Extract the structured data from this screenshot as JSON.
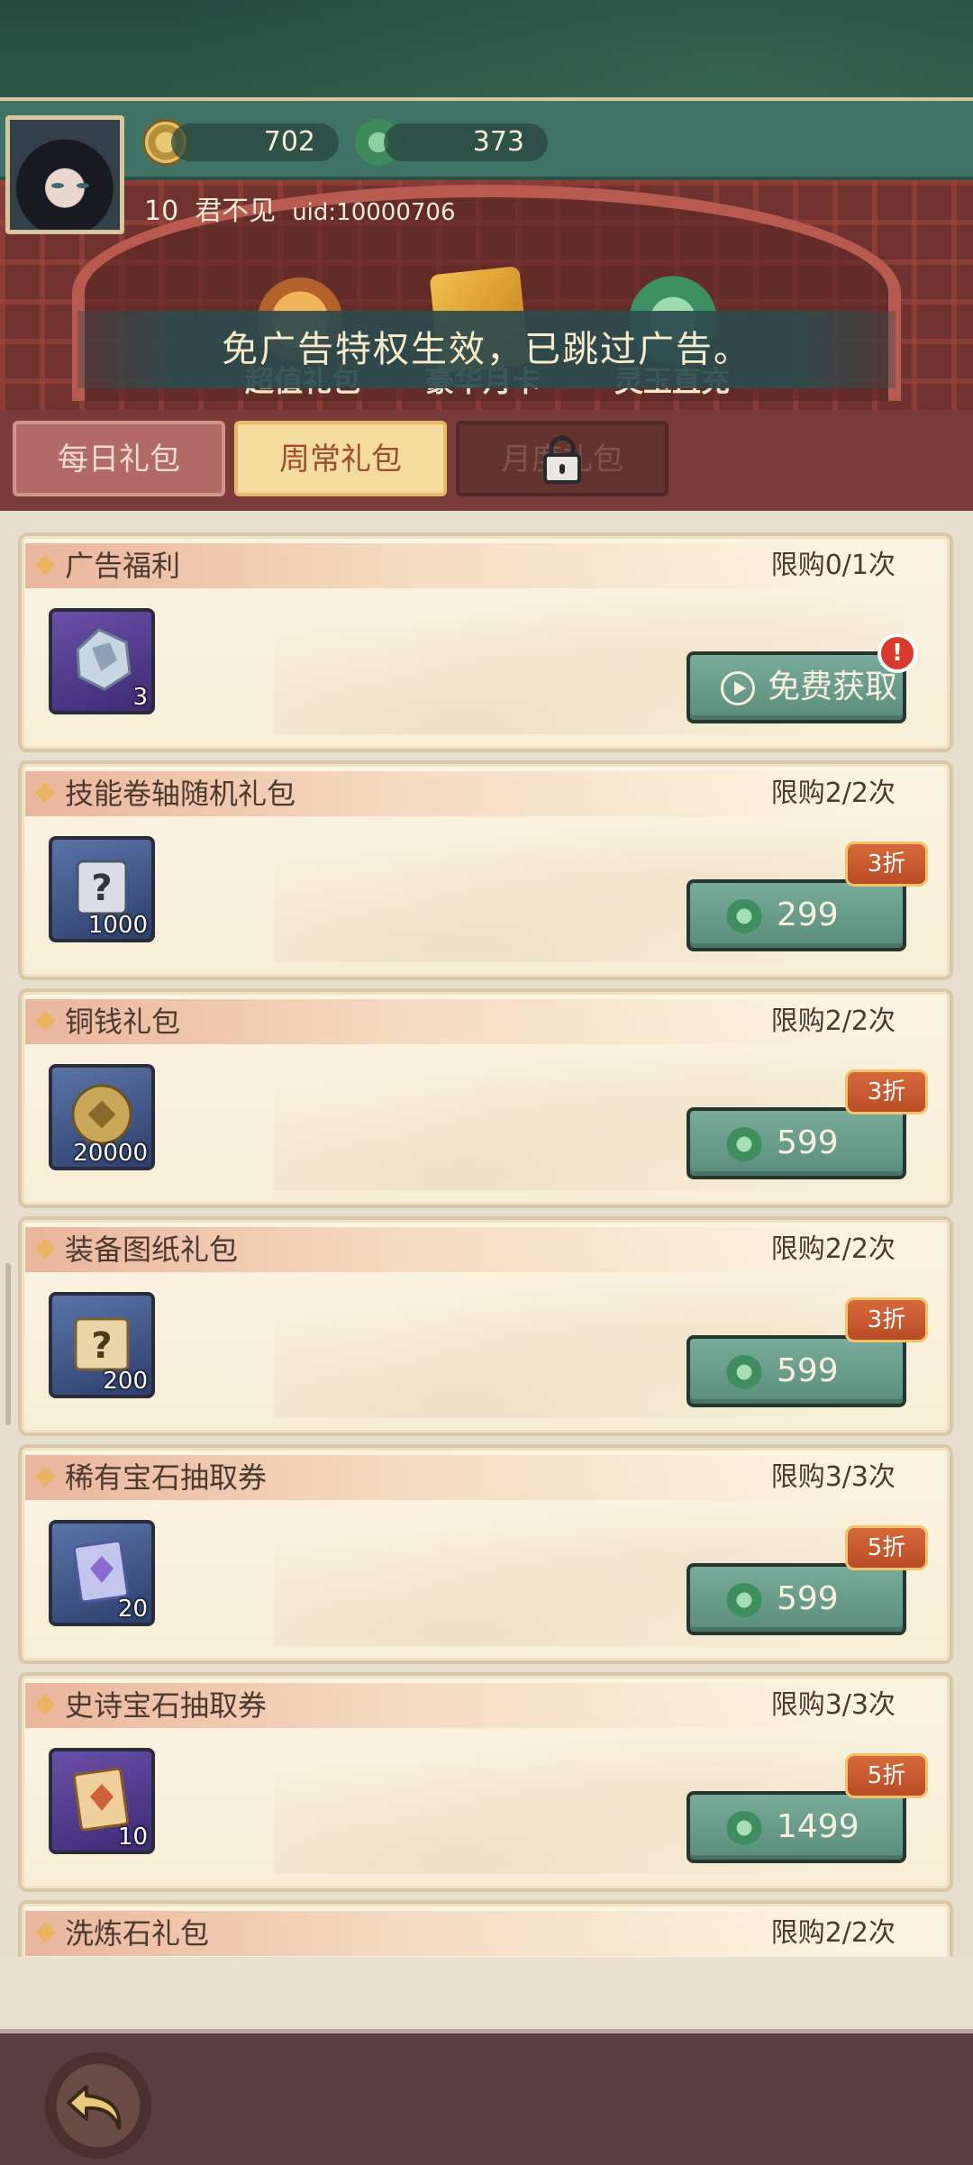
{
  "player": {
    "coins": "702",
    "jade": "373",
    "level": "10",
    "name": "君不见",
    "uid": "uid:10000706"
  },
  "top_categories": [
    {
      "label": "超值礼包",
      "icon": "gourd-icon"
    },
    {
      "label": "豪华月卡",
      "icon": "month-card-icon"
    },
    {
      "label": "灵玉直充",
      "icon": "jade-pile-icon"
    }
  ],
  "toast": "免广告特权生效，已跳过广告。",
  "tabs": [
    {
      "label": "每日礼包",
      "state": "normal"
    },
    {
      "label": "周常礼包",
      "state": "selected"
    },
    {
      "label": "月度礼包",
      "state": "locked"
    }
  ],
  "packs": [
    {
      "title": "广告福利",
      "limit": "限购0/1次",
      "qty": "3",
      "icon": "ore-crystal-icon",
      "button": "免费获取",
      "button_type": "free",
      "badge": "!"
    },
    {
      "title": "技能卷轴随机礼包",
      "limit": "限购2/2次",
      "qty": "1000",
      "icon": "mystery-scroll-icon",
      "price": "299",
      "discount": "3折"
    },
    {
      "title": "铜钱礼包",
      "limit": "限购2/2次",
      "qty": "20000",
      "icon": "copper-coin-icon",
      "price": "599",
      "discount": "3折"
    },
    {
      "title": "装备图纸礼包",
      "limit": "限购2/2次",
      "qty": "200",
      "icon": "blueprint-icon",
      "price": "599",
      "discount": "3折"
    },
    {
      "title": "稀有宝石抽取券",
      "limit": "限购3/3次",
      "qty": "20",
      "icon": "rare-gem-ticket-icon",
      "price": "599",
      "discount": "5折"
    },
    {
      "title": "史诗宝石抽取券",
      "limit": "限购3/3次",
      "qty": "10",
      "icon": "epic-gem-ticket-icon",
      "price": "1499",
      "discount": "5折"
    },
    {
      "title": "洗炼石礼包",
      "limit": "限购2/2次"
    }
  ],
  "colors": {
    "button_green": "#5b8d7d",
    "discount_orange": "#c85a2f",
    "tab_selected": "#f4dc9f",
    "header_green": "#3f7365"
  }
}
